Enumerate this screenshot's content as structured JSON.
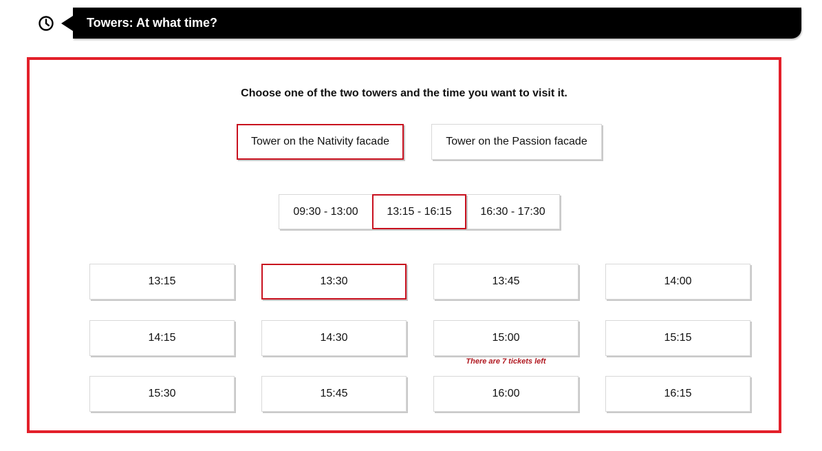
{
  "header": {
    "icon": "clock-icon",
    "title": "Towers: At what time?"
  },
  "colors": {
    "accent": "#e3202a",
    "selected_border": "#c8101e",
    "title_bar": "#000000",
    "notice": "#b01820"
  },
  "main": {
    "instructions": "Choose one of the two towers and the time you want to visit it.",
    "towers": [
      {
        "label": "Tower on the Nativity facade",
        "selected": true
      },
      {
        "label": "Tower on the Passion facade",
        "selected": false
      }
    ],
    "time_ranges": [
      {
        "label": "09:30 - 13:00",
        "selected": false
      },
      {
        "label": "13:15 - 16:15",
        "selected": true
      },
      {
        "label": "16:30 - 17:30",
        "selected": false
      }
    ],
    "slots": [
      {
        "label": "13:15",
        "selected": false
      },
      {
        "label": "13:30",
        "selected": true
      },
      {
        "label": "13:45",
        "selected": false
      },
      {
        "label": "14:00",
        "selected": false
      },
      {
        "label": "14:15",
        "selected": false
      },
      {
        "label": "14:30",
        "selected": false
      },
      {
        "label": "15:00",
        "selected": false,
        "notice": "There are 7 tickets left"
      },
      {
        "label": "15:15",
        "selected": false
      },
      {
        "label": "15:30",
        "selected": false
      },
      {
        "label": "15:45",
        "selected": false
      },
      {
        "label": "16:00",
        "selected": false
      },
      {
        "label": "16:15",
        "selected": false
      }
    ]
  }
}
